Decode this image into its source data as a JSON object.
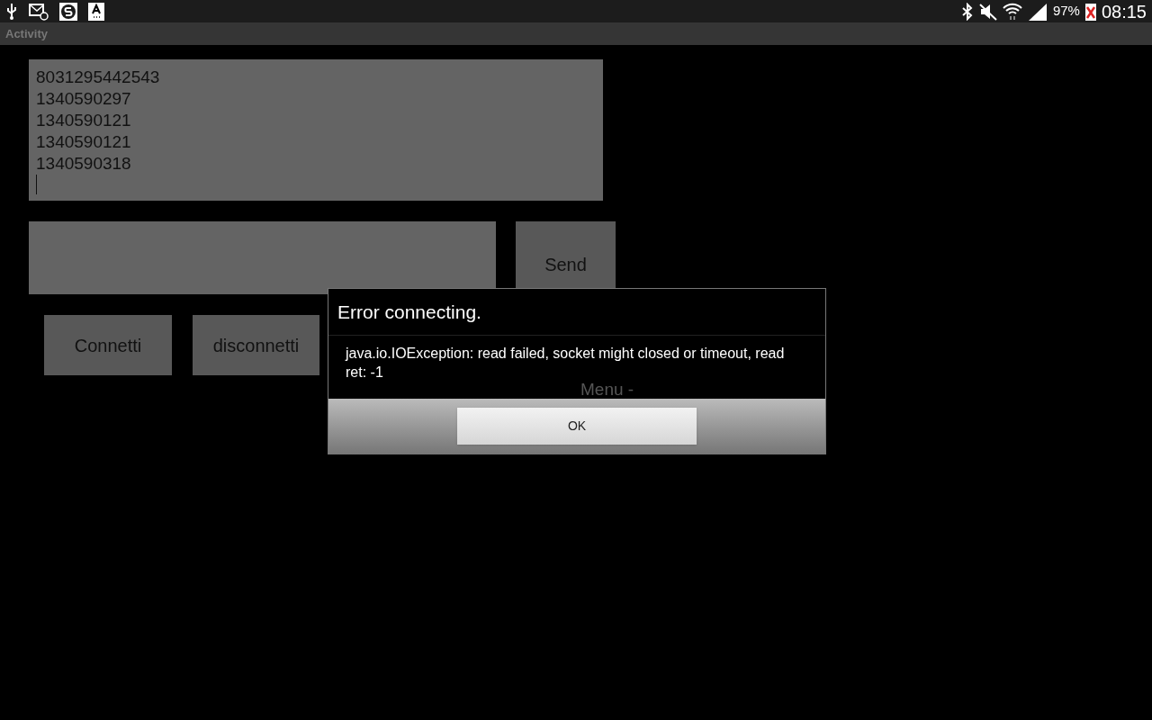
{
  "status_bar": {
    "battery": "97%",
    "time": "08:15"
  },
  "action_bar": {
    "title": "Activity"
  },
  "log_box": {
    "lines": [
      "8031295442543",
      "1340590297",
      "1340590121",
      "1340590121",
      "1340590318"
    ]
  },
  "send_button": "Send",
  "buttons": [
    "Connetti",
    "disconnetti"
  ],
  "background_text": "Menu -",
  "dialog": {
    "title": "Error connecting.",
    "message": "java.io.IOException: read failed, socket might closed or timeout, read ret: -1",
    "button": "OK"
  }
}
